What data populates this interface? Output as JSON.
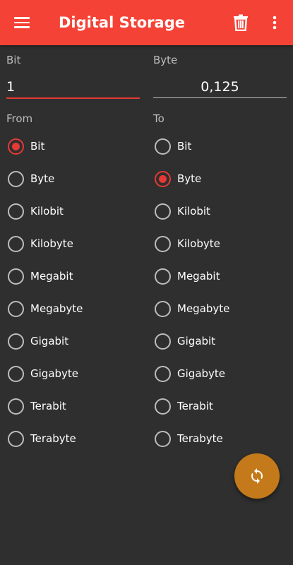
{
  "app_bar": {
    "title": "Digital Storage",
    "background_color": "#f44336",
    "menu_icon": "hamburger-menu-icon",
    "delete_icon": "trash-icon",
    "overflow_icon": "more-vertical-icon"
  },
  "input": {
    "label": "Bit",
    "value": "1"
  },
  "output": {
    "label": "Byte",
    "value": "0,125"
  },
  "from": {
    "label": "From",
    "selected": "Bit",
    "options": [
      "Bit",
      "Byte",
      "Kilobit",
      "Kilobyte",
      "Megabit",
      "Megabyte",
      "Gigabit",
      "Gigabyte",
      "Terabit",
      "Terabyte"
    ]
  },
  "to": {
    "label": "To",
    "selected": "Byte",
    "options": [
      "Bit",
      "Byte",
      "Kilobit",
      "Kilobyte",
      "Megabit",
      "Megabyte",
      "Gigabit",
      "Gigabyte",
      "Terabit",
      "Terabyte"
    ]
  },
  "fab": {
    "icon": "swap-refresh-icon",
    "color": "#c47a1a"
  },
  "colors": {
    "background": "#2f2f2f",
    "accent": "#e53935"
  }
}
